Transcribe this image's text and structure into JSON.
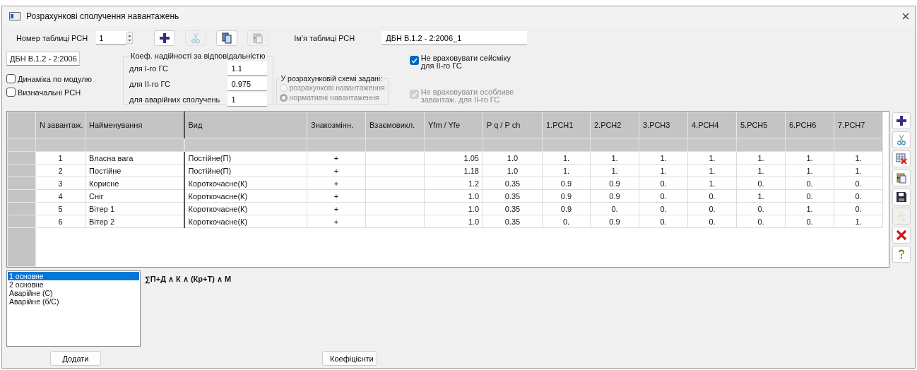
{
  "window": {
    "title": "Розрахункові сполучення навантажень"
  },
  "table_number": {
    "label": "Номер таблиці РСН",
    "value": "1"
  },
  "toolbar": [
    {
      "kind": "add",
      "disabled": false
    },
    {
      "kind": "cut",
      "disabled": true
    },
    {
      "kind": "copy",
      "disabled": false
    },
    {
      "kind": "paste",
      "disabled": true
    }
  ],
  "table_name": {
    "label": "Ім'я таблиці РСН",
    "value": "ДБН В.1.2 - 2:2006_1"
  },
  "norm": {
    "value": "ДБН В.1.2 - 2:2006"
  },
  "options": [
    {
      "label": "Динаміка по модулю",
      "checked": false
    },
    {
      "label": "Визначальні РСН",
      "checked": false
    }
  ],
  "reliability": {
    "title": "Коеф. надійності за відповідальністю",
    "rows": [
      {
        "label": "для I-го ГС",
        "value": "1.1"
      },
      {
        "label": "для II-го ГС",
        "value": "0.975"
      },
      {
        "label": "для аварійних сполучень",
        "value": "1"
      }
    ]
  },
  "scheme": {
    "title": "У розрахунковій схемі задані:",
    "disabled": true,
    "options": [
      {
        "label": "розрахункові навантаження",
        "selected": false
      },
      {
        "label": "нормативні навантаження",
        "selected": true
      }
    ]
  },
  "exclusions": [
    {
      "label": "Не враховувати сейсміку для II-го ГС",
      "checked": true,
      "disabled": false
    },
    {
      "label": "Не враховувати особливе завантаж. для II-го ГС",
      "checked": true,
      "disabled": true
    }
  ],
  "table": {
    "columns": [
      "N завантаж.",
      "Найменування",
      "Вид",
      "Знакозмінн.",
      "Взаємовикл.",
      "Yfm / Yfe",
      "P q / P ch",
      "1.РСН1",
      "2.РСН2",
      "3.РСН3",
      "4.РСН4",
      "5.РСН5",
      "6.РСН6",
      "7.РСН7"
    ],
    "rows": [
      {
        "cells": [
          "1",
          "Власна вага",
          "Постійне(П)",
          "+",
          "",
          "1.05",
          "1.0",
          "1.",
          "1.",
          "1.",
          "1.",
          "1.",
          "1.",
          "1."
        ]
      },
      {
        "cells": [
          "2",
          "Постійне",
          "Постійне(П)",
          "+",
          "",
          "1.18",
          "1.0",
          "1.",
          "1.",
          "1.",
          "1.",
          "1.",
          "1.",
          "1."
        ]
      },
      {
        "cells": [
          "3",
          "Корисне",
          "Короткочасне(К)",
          "+",
          "",
          "1.2",
          "0.35",
          "0.9",
          "0.9",
          "0.",
          "1.",
          "0.",
          "0.",
          "0."
        ]
      },
      {
        "cells": [
          "4",
          "Сніг",
          "Короткочасне(К)",
          "+",
          "",
          "1.0",
          "0.35",
          "0.9",
          "0.9",
          "0.",
          "0.",
          "1.",
          "0.",
          "0."
        ]
      },
      {
        "cells": [
          "5",
          "Вітер 1",
          "Короткочасне(К)",
          "+",
          "",
          "1.0",
          "0.35",
          "0.9",
          "0.",
          "0.",
          "0.",
          "0.",
          "1.",
          "0."
        ]
      },
      {
        "cells": [
          "6",
          "Вітер 2",
          "Короткочасне(К)",
          "+",
          "",
          "1.0",
          "0.35",
          "0.",
          "0.9",
          "0.",
          "0.",
          "0.",
          "0.",
          "1."
        ]
      }
    ]
  },
  "side_toolbar": [
    {
      "kind": "add",
      "disabled": false
    },
    {
      "kind": "cut",
      "disabled": false
    },
    {
      "kind": "delete-grid",
      "disabled": false
    },
    {
      "kind": "paste",
      "disabled": false
    },
    {
      "kind": "save",
      "disabled": false
    },
    {
      "kind": "formula",
      "disabled": true
    },
    {
      "kind": "delete",
      "disabled": false
    },
    {
      "kind": "help",
      "disabled": false
    }
  ],
  "combination_types": [
    {
      "label": "1 основне",
      "selected": true
    },
    {
      "label": "2 основне",
      "selected": false
    },
    {
      "label": "Аварійне (С)",
      "selected": false
    },
    {
      "label": "Аварійне (б/С)",
      "selected": false
    }
  ],
  "formula": "∑П+Д ∧ К ∧ (Кр+Т) ∧ М",
  "buttons": [
    "Додати",
    "Коефіцієнти"
  ]
}
